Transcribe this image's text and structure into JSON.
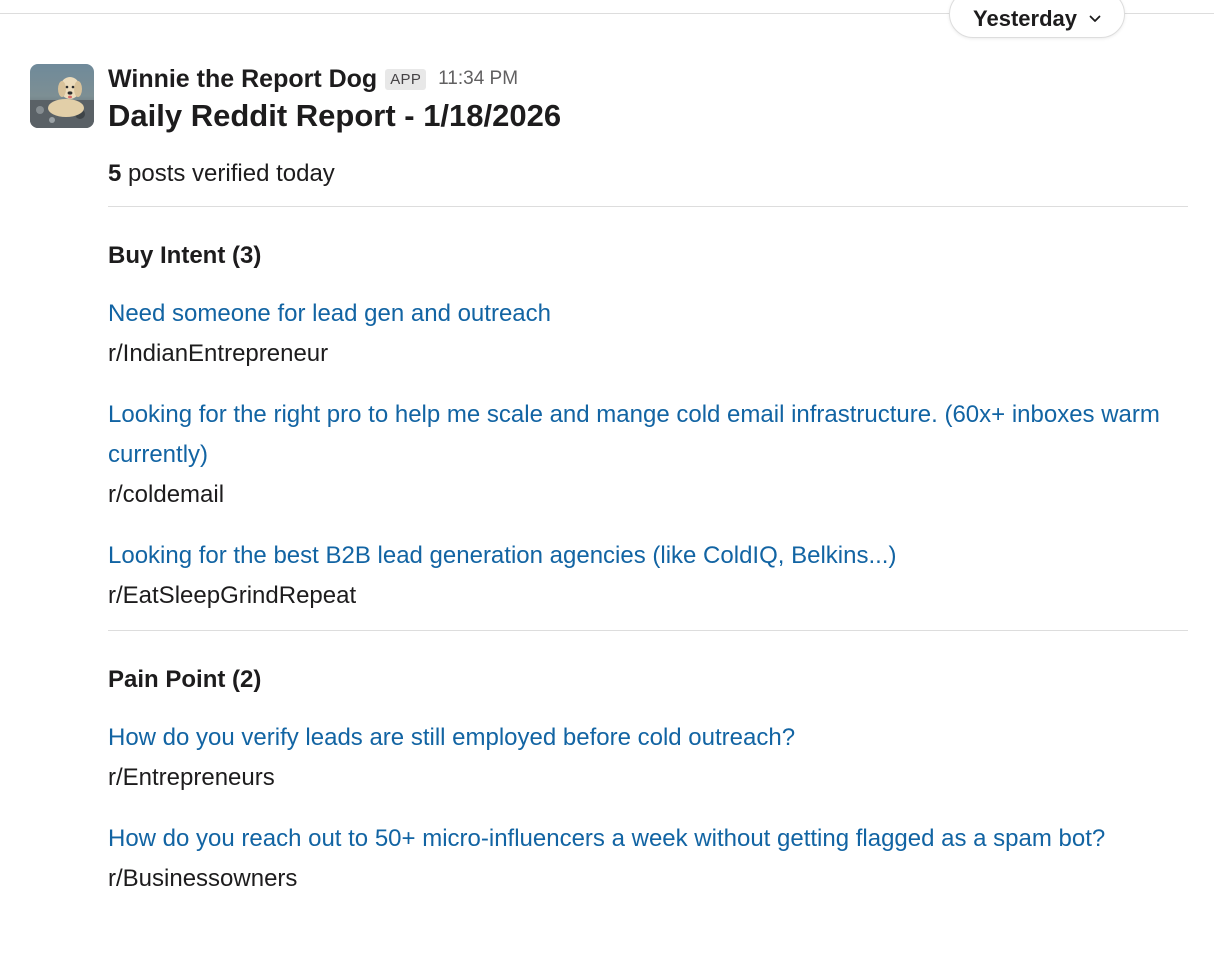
{
  "day_divider": {
    "label": "Yesterday"
  },
  "message": {
    "sender": "Winnie the Report Dog",
    "badge": "APP",
    "timestamp": "11:34 PM",
    "avatar_icon": "dog-photo-avatar",
    "title": "Daily Reddit Report - 1/18/2026",
    "summary": {
      "count": "5",
      "text": " posts verified today"
    },
    "sections": [
      {
        "title": "Buy Intent (3)",
        "posts": [
          {
            "title": "Need someone for lead gen and outreach",
            "subreddit": "r/IndianEntrepreneur"
          },
          {
            "title": "Looking for the right pro to help me scale and mange cold email infrastructure. (60x+ inboxes warm currently)",
            "subreddit": "r/coldemail"
          },
          {
            "title": "Looking for the best B2B lead generation agencies (like ColdIQ, Belkins...)",
            "subreddit": "r/EatSleepGrindRepeat"
          }
        ]
      },
      {
        "title": "Pain Point (2)",
        "posts": [
          {
            "title": "How do you verify leads are still employed before cold outreach?",
            "subreddit": "r/Entrepreneurs"
          },
          {
            "title": "How do you reach out to 50+ micro-influencers a week without getting flagged as a spam bot?",
            "subreddit": "r/Businessowners"
          }
        ]
      }
    ]
  },
  "colors": {
    "link": "#1264a3",
    "text": "#1d1c1d",
    "muted": "#616061",
    "divider": "#dddddd"
  }
}
